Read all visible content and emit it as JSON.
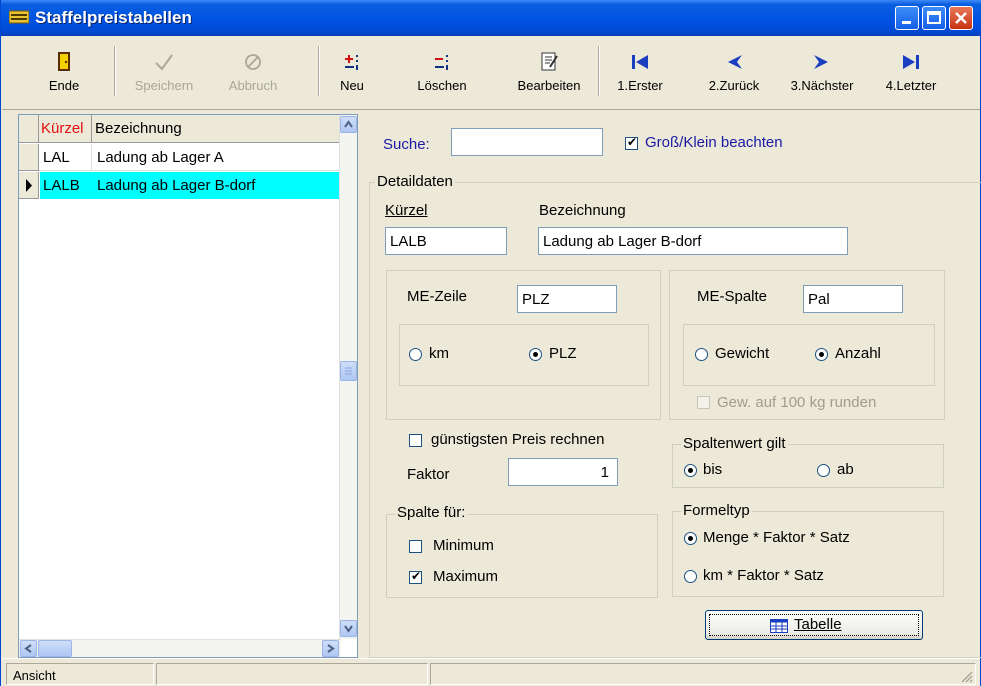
{
  "window": {
    "title": "Staffelpreistabellen"
  },
  "toolbar": {
    "ende": "Ende",
    "speichern": "Speichern",
    "abbruch": "Abbruch",
    "neu": "Neu",
    "loeschen": "Löschen",
    "bearbeiten": "Bearbeiten",
    "erster": "1.Erster",
    "zurueck": "2.Zurück",
    "naechster": "3.Nächster",
    "letzter": "4.Letzter"
  },
  "grid": {
    "headers": {
      "kuerzel": "Kürzel",
      "bezeichnung": "Bezeichnung"
    },
    "rows": [
      {
        "kuerzel": "LAL",
        "bezeichnung": "Ladung ab Lager A"
      },
      {
        "kuerzel": "LALB",
        "bezeichnung": "Ladung ab Lager B-dorf"
      }
    ],
    "selected_row_color": "#00ffff"
  },
  "search": {
    "label": "Suche:",
    "value": "",
    "case_label": "Groß/Klein beachten",
    "case_checked": true
  },
  "details": {
    "legend": "Detaildaten",
    "kuerzel_label": "Kürzel",
    "kuerzel_value": "LALB",
    "bezeichnung_label": "Bezeichnung",
    "bezeichnung_value": "Ladung ab Lager B-dorf"
  },
  "me_zeile": {
    "label": "ME-Zeile",
    "value": "PLZ",
    "opt_km": "km",
    "opt_plz": "PLZ",
    "selected": "PLZ"
  },
  "me_spalte": {
    "label": "ME-Spalte",
    "value": "Pal",
    "opt_gewicht": "Gewicht",
    "opt_anzahl": "Anzahl",
    "selected": "Anzahl",
    "round_label": "Gew. auf 100 kg runden",
    "round_checked": false
  },
  "guenstig": {
    "label": "günstigsten Preis rechnen",
    "checked": false
  },
  "faktor": {
    "label": "Faktor",
    "value": "1"
  },
  "spaltenwert": {
    "legend": "Spaltenwert gilt",
    "opt_bis": "bis",
    "opt_ab": "ab",
    "selected": "bis"
  },
  "spalte_fuer": {
    "legend": "Spalte für:",
    "minimum_label": "Minimum",
    "minimum_checked": false,
    "maximum_label": "Maximum",
    "maximum_checked": true
  },
  "formeltyp": {
    "legend": "Formeltyp",
    "opt_menge": "Menge * Faktor * Satz",
    "opt_km": "km * Faktor * Satz",
    "selected": "Menge * Faktor * Satz"
  },
  "tabelle_button": "Tabelle",
  "status": {
    "pane1": "Ansicht"
  },
  "colors": {
    "title_bar": "#0054e3",
    "accent_green": "#21a121",
    "label_blue": "#1a1aa6"
  }
}
